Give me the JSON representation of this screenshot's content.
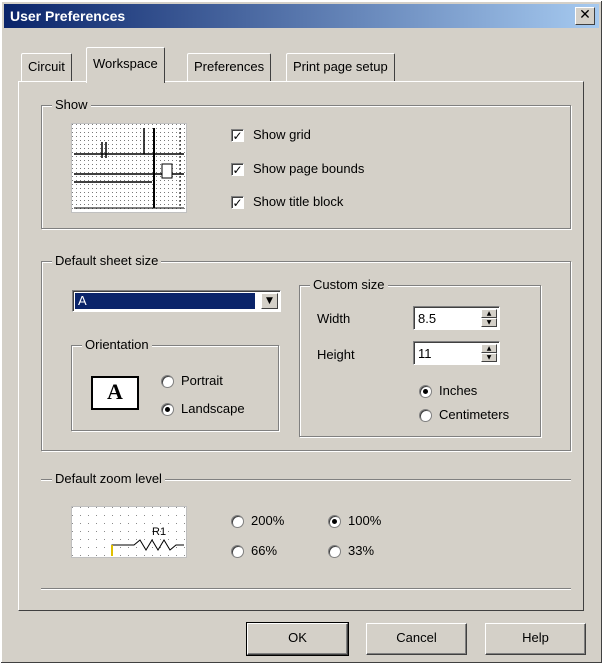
{
  "window": {
    "title": "User Preferences",
    "close_glyph": "✕"
  },
  "tabs": [
    {
      "label": "Circuit",
      "active": false
    },
    {
      "label": "Workspace",
      "active": true
    },
    {
      "label": "Preferences",
      "active": false
    },
    {
      "label": "Print page setup",
      "active": false
    }
  ],
  "show_group": {
    "legend": "Show",
    "checkboxes": [
      {
        "label": "Show grid",
        "checked": true
      },
      {
        "label": "Show page bounds",
        "checked": true
      },
      {
        "label": "Show title block",
        "checked": true
      }
    ]
  },
  "sheet_size": {
    "legend": "Default sheet size",
    "selected": "A",
    "orientation": {
      "legend": "Orientation",
      "icon_letter": "A",
      "options": [
        {
          "label": "Portrait",
          "checked": false
        },
        {
          "label": "Landscape",
          "checked": true
        }
      ]
    },
    "custom": {
      "legend": "Custom size",
      "width_label": "Width",
      "width_value": "8.5",
      "height_label": "Height",
      "height_value": "11",
      "units": [
        {
          "label": "Inches",
          "checked": true
        },
        {
          "label": "Centimeters",
          "checked": false
        }
      ]
    }
  },
  "zoom": {
    "legend": "Default zoom level",
    "preview_label": "R1",
    "options": [
      {
        "label": "200%",
        "checked": false
      },
      {
        "label": "100%",
        "checked": true
      },
      {
        "label": "66%",
        "checked": false
      },
      {
        "label": "33%",
        "checked": false
      }
    ]
  },
  "buttons": {
    "ok": "OK",
    "cancel": "Cancel",
    "help": "Help"
  },
  "colors": {
    "title_bar": "#0a246a",
    "selection": "#0a246a",
    "face": "#d4d0c8"
  }
}
